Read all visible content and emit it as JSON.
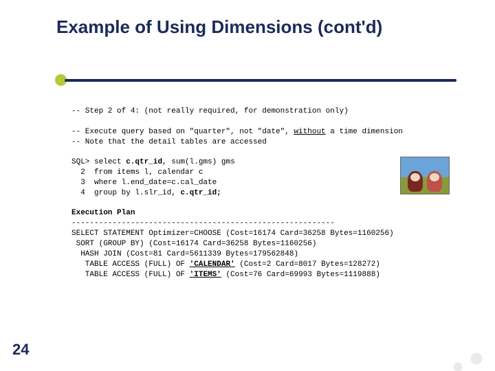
{
  "slide": {
    "title": "Example of Using Dimensions (cont'd)",
    "page_number": "24"
  },
  "code": {
    "c1": "-- Step 2 of 4: (not really required, for demonstration only)",
    "c2a": "-- Execute query based on \"quarter\", not \"date\", ",
    "c2u": "without",
    "c2b": " a time dimension",
    "c3": "-- Note that the detail tables are accessed",
    "sql_prompt": "SQL> ",
    "sql_l1a": "select ",
    "sql_l1b": "c.qtr_id",
    "sql_l1c": ", sum(l.gms) gms",
    "sql_l2": "  2  from items l, calendar c",
    "sql_l3": "  3  where l.end_date=c.cal_date",
    "sql_l4a": "  4  group by l.slr_id, ",
    "sql_l4b": "c.qtr_id;",
    "ep_title": "Execution Plan",
    "ep_rule": "----------------------------------------------------------",
    "ep_l1": "SELECT STATEMENT Optimizer=CHOOSE (Cost=16174 Card=36258 Bytes=1160256)",
    "ep_l2": " SORT (GROUP BY) (Cost=16174 Card=36258 Bytes=1160256)",
    "ep_l3": "  HASH JOIN (Cost=81 Card=5611339 Bytes=179562848)",
    "ep_l4a": "   TABLE ACCESS (FULL) OF ",
    "ep_l4u": "'CALENDAR'",
    "ep_l4b": " (Cost=2 Card=8017 Bytes=128272)",
    "ep_l5a": "   TABLE ACCESS (FULL) OF ",
    "ep_l5u": "'ITEMS'",
    "ep_l5b": " (Cost=76 Card=69993 Bytes=1119888)"
  }
}
